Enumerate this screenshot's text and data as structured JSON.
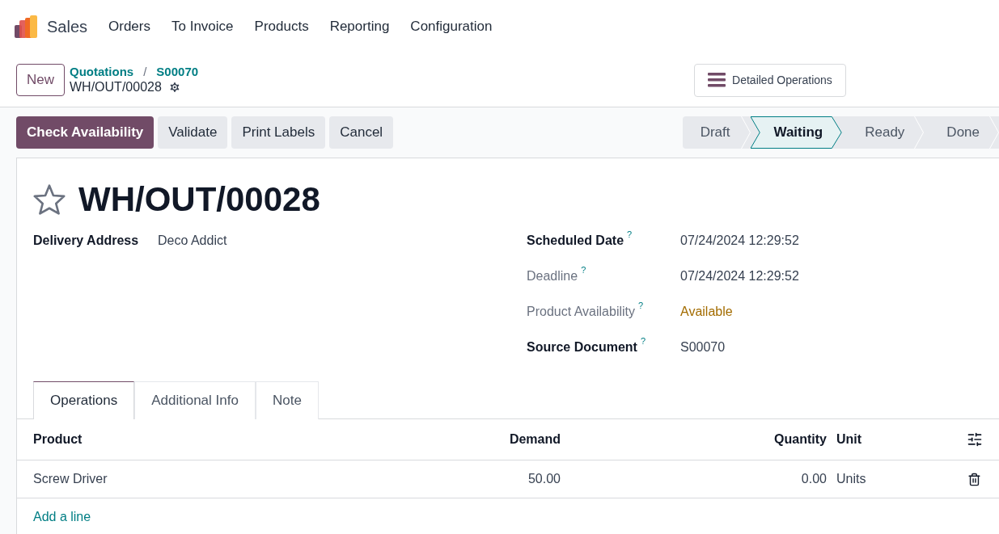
{
  "navbar": {
    "app": "Sales",
    "menu": [
      "Orders",
      "To Invoice",
      "Products",
      "Reporting",
      "Configuration"
    ]
  },
  "control_panel": {
    "new_button": "New",
    "breadcrumbs": [
      "Quotations",
      "S00070"
    ],
    "separator": "/",
    "current": "WH/OUT/00028",
    "detailed_button": "Detailed Operations"
  },
  "actions": [
    {
      "label": "Check Availability",
      "kind": "primary"
    },
    {
      "label": "Validate",
      "kind": "secondary"
    },
    {
      "label": "Print Labels",
      "kind": "secondary"
    },
    {
      "label": "Cancel",
      "kind": "secondary"
    }
  ],
  "stages": [
    {
      "label": "Draft",
      "selected": false
    },
    {
      "label": "Waiting",
      "selected": true
    },
    {
      "label": "Ready",
      "selected": false
    },
    {
      "label": "Done",
      "selected": false
    }
  ],
  "form": {
    "title": "WH/OUT/00028",
    "starred": false,
    "left_fields": [
      {
        "label": "Delivery Address",
        "value": "Deco Addict",
        "muted": false,
        "warning": false
      }
    ],
    "right_fields": [
      {
        "label": "Scheduled Date",
        "help": "?",
        "value": "07/24/2024 12:29:52",
        "muted": false,
        "warning": false
      },
      {
        "label": "Deadline",
        "help": "?",
        "value": "07/24/2024 12:29:52",
        "muted": true,
        "warning": false
      },
      {
        "label": "Product Availability",
        "help": "?",
        "value": "Available",
        "muted": true,
        "warning": true
      },
      {
        "label": "Source Document",
        "help": "?",
        "value": "S00070",
        "muted": false,
        "warning": false
      }
    ]
  },
  "tabs": [
    {
      "label": "Operations",
      "selected": true
    },
    {
      "label": "Additional Info",
      "selected": false
    },
    {
      "label": "Note",
      "selected": false
    }
  ],
  "table": {
    "columns": [
      "Product",
      "Demand",
      "Quantity",
      "Unit"
    ],
    "rows": [
      {
        "product": "Screw Driver",
        "demand": "50.00",
        "quantity": "0.00",
        "unit": "Units"
      }
    ],
    "add_line": "Add a line"
  }
}
